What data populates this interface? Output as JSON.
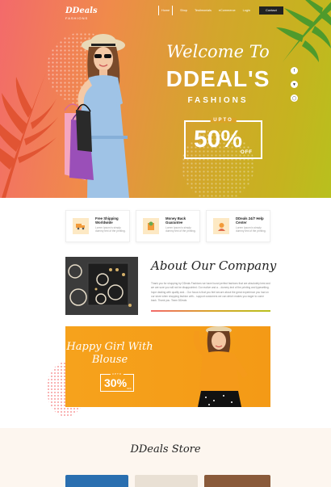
{
  "brand": {
    "name": "DDeals",
    "tagline": "FASHIONS"
  },
  "nav": {
    "items": [
      {
        "label": "Home",
        "active": true
      },
      {
        "label": "Shop"
      },
      {
        "label": "Testimonials"
      },
      {
        "label": "eCommerce"
      },
      {
        "label": "Login"
      }
    ],
    "contact_label": "Contact"
  },
  "hero": {
    "welcome": "Welcome To",
    "title": "DDEAL'S",
    "subtitle": "FASHIONS",
    "offer_prefix": "UPTO",
    "offer_value": "50%",
    "offer_suffix": "OFF",
    "social_icons": [
      "facebook-icon",
      "twitter-icon",
      "instagram-icon"
    ]
  },
  "features": [
    {
      "title": "Free Shipping Worldwide",
      "desc": "Lorem Ipsum is simply dummy text of the printing.",
      "icon": "truck-icon"
    },
    {
      "title": "Money Back Guarantee",
      "desc": "Lorem Ipsum is simply dummy text of the printing.",
      "icon": "money-back-icon"
    },
    {
      "title": "DDeals 24/7 Help Center",
      "desc": "Lorem Ipsum is simply dummy text of the printing.",
      "icon": "support-icon"
    }
  ],
  "about": {
    "title": "About Our Company",
    "text": "Thank you for shopping by DDeals Fashions we have found perfect fashions that are absolutely best and we are sure you will not be disappointed. Our motive and a... dummy text of the printing and typesetting. hope dealing with quality and... Our focus is that you feel secure about the great experience you had on our store when shopping fashion with... support customers we can which makes you eager to come back. Thank you. Team DDeals"
  },
  "promo": {
    "title": "Happy Girl With Blouse",
    "offer_prefix": "UPTO",
    "offer_value": "30%",
    "offer_suffix": "OFF"
  },
  "store": {
    "title": "DDeals Store"
  },
  "colors": {
    "accent_orange": "#f6a21c",
    "hero_start": "#f36a6b",
    "hero_end": "#b8c01e",
    "dark": "#222222"
  }
}
